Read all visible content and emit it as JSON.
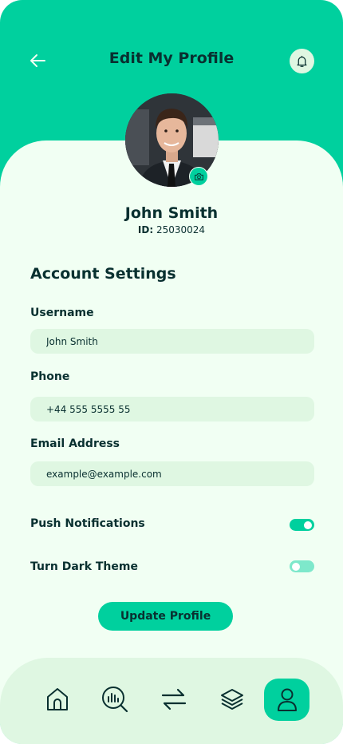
{
  "header": {
    "title": "Edit My Profile"
  },
  "profile": {
    "name": "John Smith",
    "id_label": "ID:",
    "id_value": "25030024"
  },
  "account": {
    "title": "Account Settings",
    "username_label": "Username",
    "username_value": "John Smith",
    "phone_label": "Phone",
    "phone_value": "+44 555 5555 55",
    "email_label": "Email Address",
    "email_value": "example@example.com"
  },
  "toggles": [
    {
      "label": "Push Notifications",
      "on": true
    },
    {
      "label": "Turn Dark Theme",
      "on": false
    }
  ],
  "update_button": "Update Profile",
  "nav": [
    {
      "icon": "home-icon",
      "active": false
    },
    {
      "icon": "analysis-icon",
      "active": false
    },
    {
      "icon": "transactions-icon",
      "active": false
    },
    {
      "icon": "categories-icon",
      "active": false
    },
    {
      "icon": "profile-icon",
      "active": true
    }
  ],
  "colors": {
    "primary": "#00D09E",
    "background": "#F1FFF3",
    "field": "#DFF7E2",
    "text": "#093030"
  }
}
